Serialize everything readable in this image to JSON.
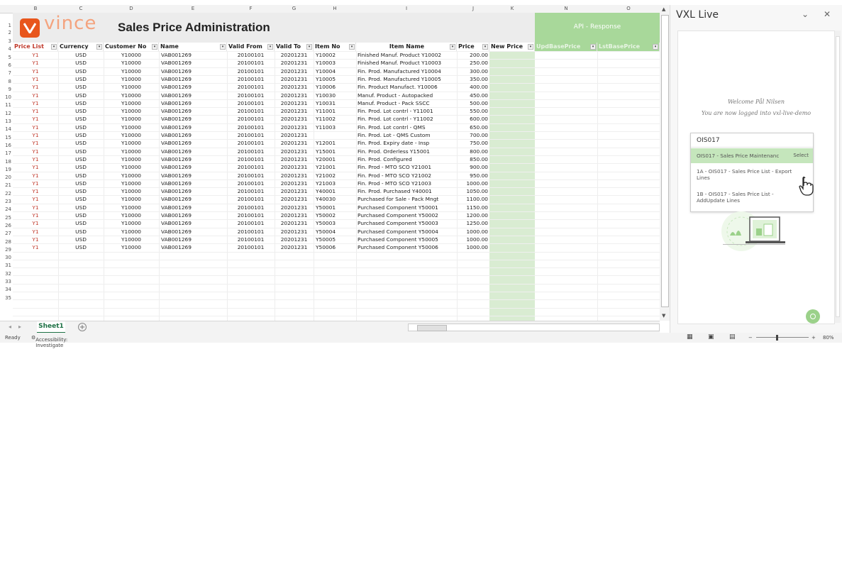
{
  "sheet": {
    "title": "Sales Price Administration",
    "logo_text": "vince",
    "api_header": "API - Response",
    "columns": [
      "B",
      "C",
      "D",
      "E",
      "F",
      "G",
      "H",
      "I",
      "J",
      "K",
      "N",
      "O"
    ],
    "headers": [
      "Price List",
      "Currency",
      "Customer No",
      "Name",
      "Valid From",
      "Valid To",
      "Item No",
      "Item Name",
      "Price",
      "New Price",
      "UpdBasePrice",
      "LstBasePrice"
    ],
    "row_numbers": [
      "1",
      "2",
      "3",
      "4",
      "5",
      "6",
      "7",
      "8",
      "9",
      "10",
      "11",
      "12",
      "13",
      "14",
      "15",
      "16",
      "17",
      "18",
      "19",
      "20",
      "21",
      "22",
      "23",
      "24",
      "25",
      "26",
      "27",
      "28",
      "29",
      "30",
      "31",
      "32",
      "33",
      "34",
      "35"
    ],
    "rows": [
      [
        "Y1",
        "USD",
        "Y10000",
        "VAB001269",
        "20100101",
        "20201231",
        "Y10002",
        "Finished Manuf. Product Y10002",
        "200.00"
      ],
      [
        "Y1",
        "USD",
        "Y10000",
        "VAB001269",
        "20100101",
        "20201231",
        "Y10003",
        "Finished Manuf. Product Y10003",
        "250.00"
      ],
      [
        "Y1",
        "USD",
        "Y10000",
        "VAB001269",
        "20100101",
        "20201231",
        "Y10004",
        "Fin. Prod. Manufactured Y10004",
        "300.00"
      ],
      [
        "Y1",
        "USD",
        "Y10000",
        "VAB001269",
        "20100101",
        "20201231",
        "Y10005",
        "Fin. Prod. Manufactured Y10005",
        "350.00"
      ],
      [
        "Y1",
        "USD",
        "Y10000",
        "VAB001269",
        "20100101",
        "20201231",
        "Y10006",
        "Fin. Product Manufact. Y10006",
        "400.00"
      ],
      [
        "Y1",
        "USD",
        "Y10000",
        "VAB001269",
        "20100101",
        "20201231",
        "Y10030",
        "Manuf. Product - Autopacked",
        "450.00"
      ],
      [
        "Y1",
        "USD",
        "Y10000",
        "VAB001269",
        "20100101",
        "20201231",
        "Y10031",
        "Manuf. Product - Pack SSCC",
        "500.00"
      ],
      [
        "Y1",
        "USD",
        "Y10000",
        "VAB001269",
        "20100101",
        "20201231",
        "Y11001",
        "Fin. Prod. Lot contrl - Y11001",
        "550.00"
      ],
      [
        "Y1",
        "USD",
        "Y10000",
        "VAB001269",
        "20100101",
        "20201231",
        "Y11002",
        "Fin. Prod. Lot contrl - Y11002",
        "600.00"
      ],
      [
        "Y1",
        "USD",
        "Y10000",
        "VAB001269",
        "20100101",
        "20201231",
        "Y11003",
        "Fin. Prod. Lot contrl - QMS",
        "650.00"
      ],
      [
        "Y1",
        "USD",
        "Y10000",
        "VAB001269",
        "20100101",
        "20201231",
        "",
        "Fin. Prod. Lot - QMS Custom",
        "700.00"
      ],
      [
        "Y1",
        "USD",
        "Y10000",
        "VAB001269",
        "20100101",
        "20201231",
        "Y12001",
        "Fin. Prod. Expiry date - Insp",
        "750.00"
      ],
      [
        "Y1",
        "USD",
        "Y10000",
        "VAB001269",
        "20100101",
        "20201231",
        "Y15001",
        "Fin. Prod. Orderless Y15001",
        "800.00"
      ],
      [
        "Y1",
        "USD",
        "Y10000",
        "VAB001269",
        "20100101",
        "20201231",
        "Y20001",
        "Fin. Prod. Configured",
        "850.00"
      ],
      [
        "Y1",
        "USD",
        "Y10000",
        "VAB001269",
        "20100101",
        "20201231",
        "Y21001",
        "Fin. Prod - MTO SCO Y21001",
        "900.00"
      ],
      [
        "Y1",
        "USD",
        "Y10000",
        "VAB001269",
        "20100101",
        "20201231",
        "Y21002",
        "Fin. Prod - MTO SCO Y21002",
        "950.00"
      ],
      [
        "Y1",
        "USD",
        "Y10000",
        "VAB001269",
        "20100101",
        "20201231",
        "Y21003",
        "Fin. Prod - MTO SCO Y21003",
        "1000.00"
      ],
      [
        "Y1",
        "USD",
        "Y10000",
        "VAB001269",
        "20100101",
        "20201231",
        "Y40001",
        "Fin. Prod. Purchased Y40001",
        "1050.00"
      ],
      [
        "Y1",
        "USD",
        "Y10000",
        "VAB001269",
        "20100101",
        "20201231",
        "Y40030",
        "Purchased for Sale - Pack Mngt",
        "1100.00"
      ],
      [
        "Y1",
        "USD",
        "Y10000",
        "VAB001269",
        "20100101",
        "20201231",
        "Y50001",
        "Purchased Component Y50001",
        "1150.00"
      ],
      [
        "Y1",
        "USD",
        "Y10000",
        "VAB001269",
        "20100101",
        "20201231",
        "Y50002",
        "Purchased Component Y50002",
        "1200.00"
      ],
      [
        "Y1",
        "USD",
        "Y10000",
        "VAB001269",
        "20100101",
        "20201231",
        "Y50003",
        "Purchased Component Y50003",
        "1250.00"
      ],
      [
        "Y1",
        "USD",
        "Y10000",
        "VAB001269",
        "20100101",
        "20201231",
        "Y50004",
        "Purchased Component Y50004",
        "1000.00"
      ],
      [
        "Y1",
        "USD",
        "Y10000",
        "VAB001269",
        "20100101",
        "20201231",
        "Y50005",
        "Purchased Component Y50005",
        "1000.00"
      ],
      [
        "Y1",
        "USD",
        "Y10000",
        "VAB001269",
        "20100101",
        "20201231",
        "Y50006",
        "Purchased Component Y50006",
        "1000.00"
      ]
    ],
    "tab_label": "Sheet1",
    "add_sheet": "+"
  },
  "status": {
    "ready": "Ready",
    "accessibility": "Accessibility: Investigate",
    "zoom": "80%"
  },
  "pane": {
    "title": "VXL Live",
    "minimize": "⌄",
    "close": "✕",
    "welcome_line1": "Welcome Pål Nilsen",
    "welcome_line2": "You are now logged into vxl-live-demo",
    "search_value": "OIS017",
    "options": [
      {
        "label": "OIS017 - Sales Price Maintenanc",
        "action": "Select"
      },
      {
        "label": "1A - OIS017 - Sales Price List - Export Lines"
      },
      {
        "label": "1B - OIS017 - Sales Price List - AddUpdate Lines"
      }
    ]
  },
  "colors": {
    "accent": "#1e7145",
    "brand": "#e8561c",
    "api_green": "#a8d89a"
  }
}
